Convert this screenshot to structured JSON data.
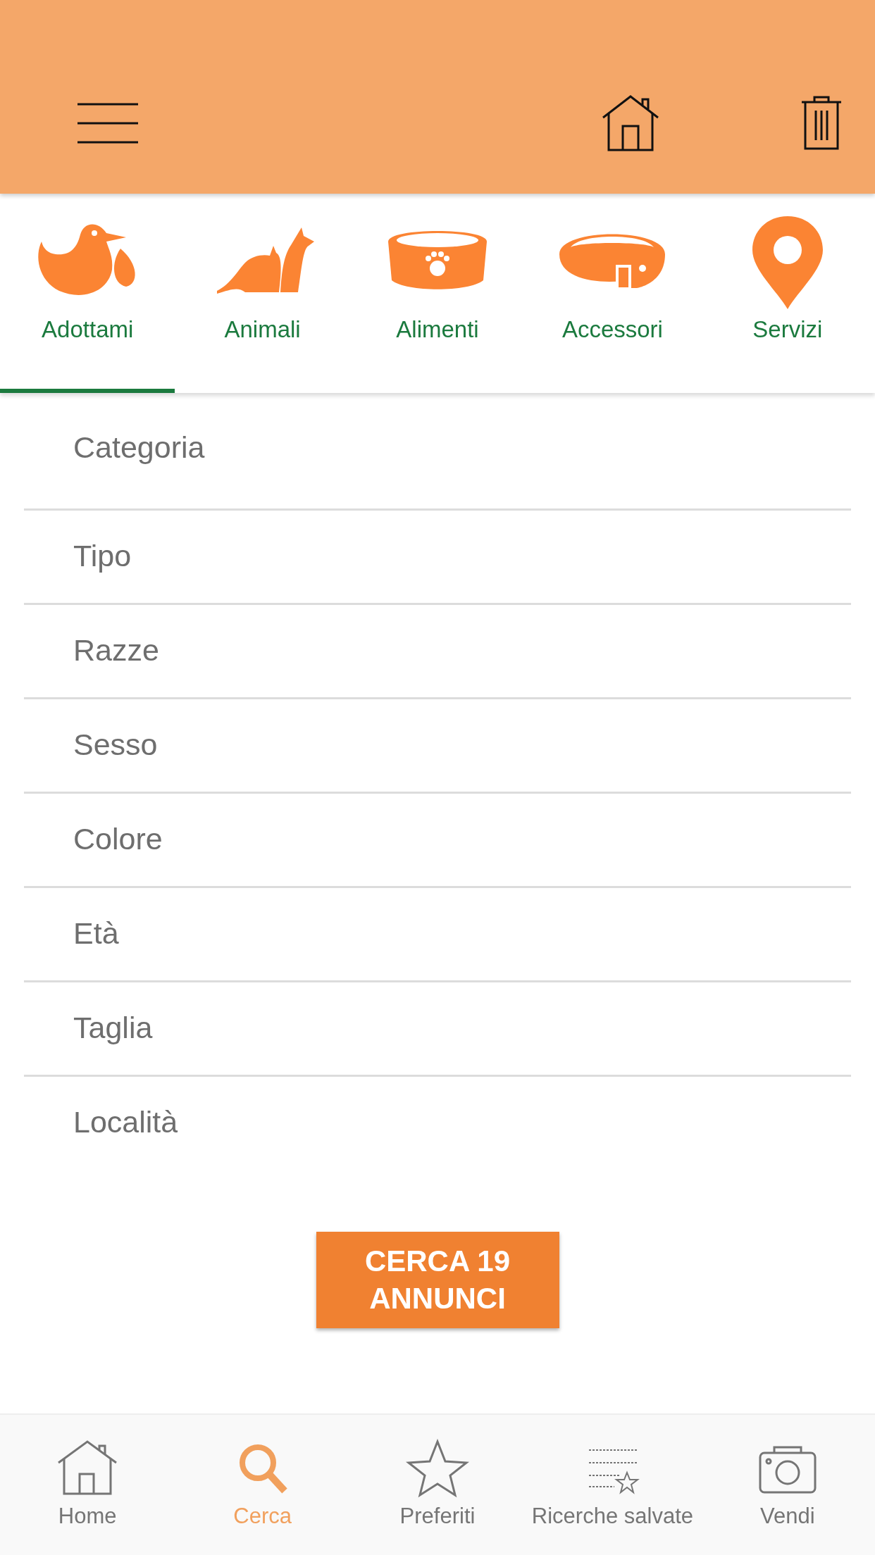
{
  "categories": [
    {
      "label": "Adottami",
      "selected": true
    },
    {
      "label": "Animali",
      "selected": false
    },
    {
      "label": "Alimenti",
      "selected": false
    },
    {
      "label": "Accessori",
      "selected": false
    },
    {
      "label": "Servizi",
      "selected": false
    }
  ],
  "filters": [
    "Categoria",
    "Tipo",
    "Razze",
    "Sesso",
    "Colore",
    "Età",
    "Taglia",
    "Località"
  ],
  "search_button": {
    "lines": [
      "CERCA 19",
      "ANNUNCI"
    ]
  },
  "bottom_nav": [
    {
      "label": "Home",
      "selected": false
    },
    {
      "label": "Cerca",
      "selected": true
    },
    {
      "label": "Preferiti",
      "selected": false
    },
    {
      "label": "Ricerche salvate",
      "selected": false
    },
    {
      "label": "Vendi",
      "selected": false
    }
  ]
}
